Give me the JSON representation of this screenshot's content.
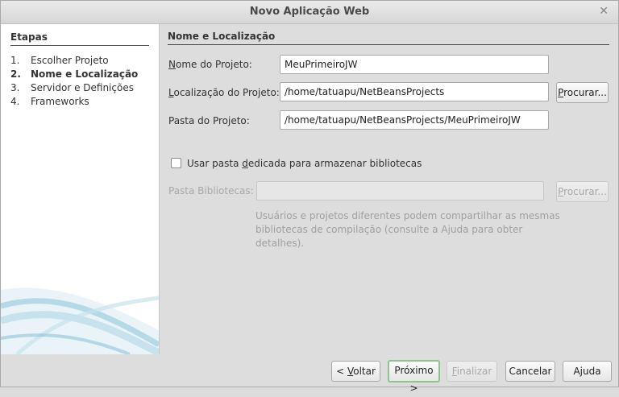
{
  "window": {
    "title": "Novo Aplicação Web",
    "close_glyph": "✕"
  },
  "steps": {
    "heading": "Etapas",
    "items": [
      {
        "num": "1.",
        "label": "Escolher Projeto"
      },
      {
        "num": "2.",
        "label": "Nome e Localização"
      },
      {
        "num": "3.",
        "label": "Servidor e Definições"
      },
      {
        "num": "4.",
        "label": "Frameworks"
      }
    ]
  },
  "panel": {
    "heading": "Nome e Localização",
    "project_name": {
      "label_mn": "N",
      "label_rest": "ome do Projeto:",
      "value": "MeuPrimeiroJW"
    },
    "project_location": {
      "label_mn": "L",
      "label_rest": "ocalização do Projeto:",
      "value": "/home/tatuapu/NetBeansProjects"
    },
    "project_folder": {
      "label": "Pasta do Projeto:",
      "value": "/home/tatuapu/NetBeansProjects/MeuPrimeiroJW"
    },
    "browse_1": {
      "mn": "P",
      "rest": "rocurar..."
    },
    "dedicated_checkbox": {
      "pre": "Usar pasta ",
      "mn": "d",
      "post": "edicada para armazenar bibliotecas"
    },
    "libraries_folder": {
      "label": "Pasta Bibliotecas:",
      "value": ""
    },
    "browse_2": {
      "mn": "P",
      "rest": "rocurar..."
    },
    "hint_line1": "Usuários e projetos diferentes podem compartilhar as mesmas",
    "hint_line2": "bibliotecas de compilação (consulte a Ajuda para obter detalhes)."
  },
  "buttons": {
    "back": {
      "pre": "< ",
      "mn": "V",
      "rest": "oltar"
    },
    "next": "Próximo >",
    "finish": {
      "mn": "F",
      "rest": "inalizar"
    },
    "cancel": "Cancelar",
    "help": "Ajuda"
  }
}
